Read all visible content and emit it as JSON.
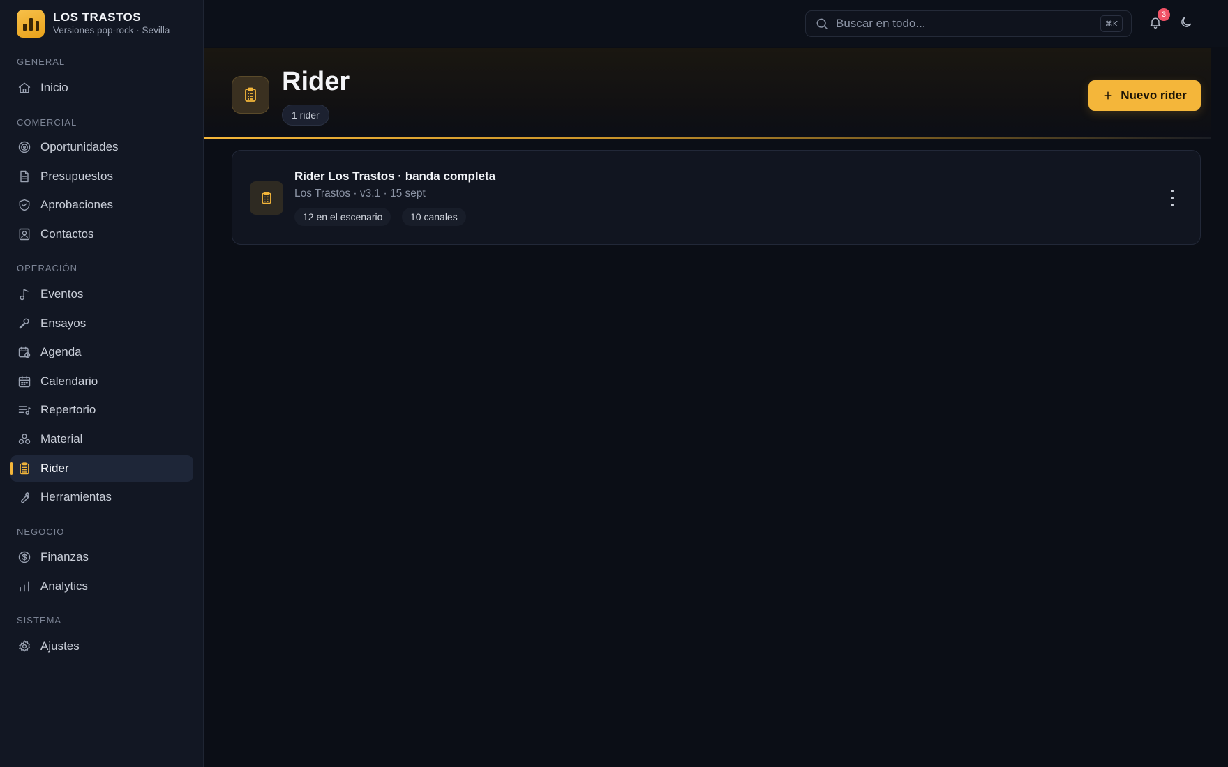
{
  "brand": {
    "title": "LOS TRASTOS",
    "subtitle": "Versiones pop-rock · Sevilla"
  },
  "sidebar": {
    "sections": {
      "general": "GENERAL",
      "comercial": "COMERCIAL",
      "operacion": "OPERACIÓN",
      "negocio": "NEGOCIO",
      "sistema": "SISTEMA"
    },
    "items": {
      "inicio": "Inicio",
      "oportunidades": "Oportunidades",
      "presupuestos": "Presupuestos",
      "aprobaciones": "Aprobaciones",
      "contactos": "Contactos",
      "eventos": "Eventos",
      "ensayos": "Ensayos",
      "agenda": "Agenda",
      "calendario": "Calendario",
      "repertorio": "Repertorio",
      "material": "Material",
      "rider": "Rider",
      "herramientas": "Herramientas",
      "finanzas": "Finanzas",
      "analytics": "Analytics",
      "ajustes": "Ajustes"
    },
    "active": "rider"
  },
  "topbar": {
    "search_placeholder": "Buscar en todo...",
    "shortcut": "⌘K",
    "notifications_count": "3"
  },
  "header": {
    "title": "Rider",
    "count": "1 rider",
    "new_button_plus": "+",
    "new_button_label": "Nuevo  rider"
  },
  "riders": [
    {
      "title": "Rider Los Trastos · banda completa",
      "meta": "Los Trastos · v3.1 · 15 sept",
      "tags": [
        "12 en el escenario",
        "10 canales"
      ]
    }
  ],
  "colors": {
    "accent": "#f4b63a",
    "background": "#0b0e16",
    "sidebar": "#121723",
    "badge": "#f05266"
  }
}
